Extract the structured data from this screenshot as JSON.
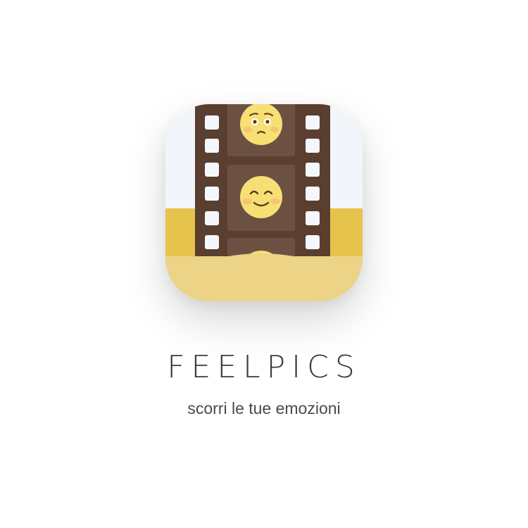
{
  "app": {
    "name": "FEELPICS",
    "tagline": "scorri le tue emozioni"
  },
  "icon": {
    "name": "film-strip-emoji-icon",
    "colors": {
      "background": "#f2f5fa",
      "film": "#5a3e30",
      "frame": "#6c5143",
      "sprocket": "#f4f7fb",
      "pocket": "#ecd386",
      "pocket_back": "#e6c44c",
      "face": "#f8df73",
      "blush": "#f4bf74",
      "feature": "#5a3a1c"
    }
  }
}
